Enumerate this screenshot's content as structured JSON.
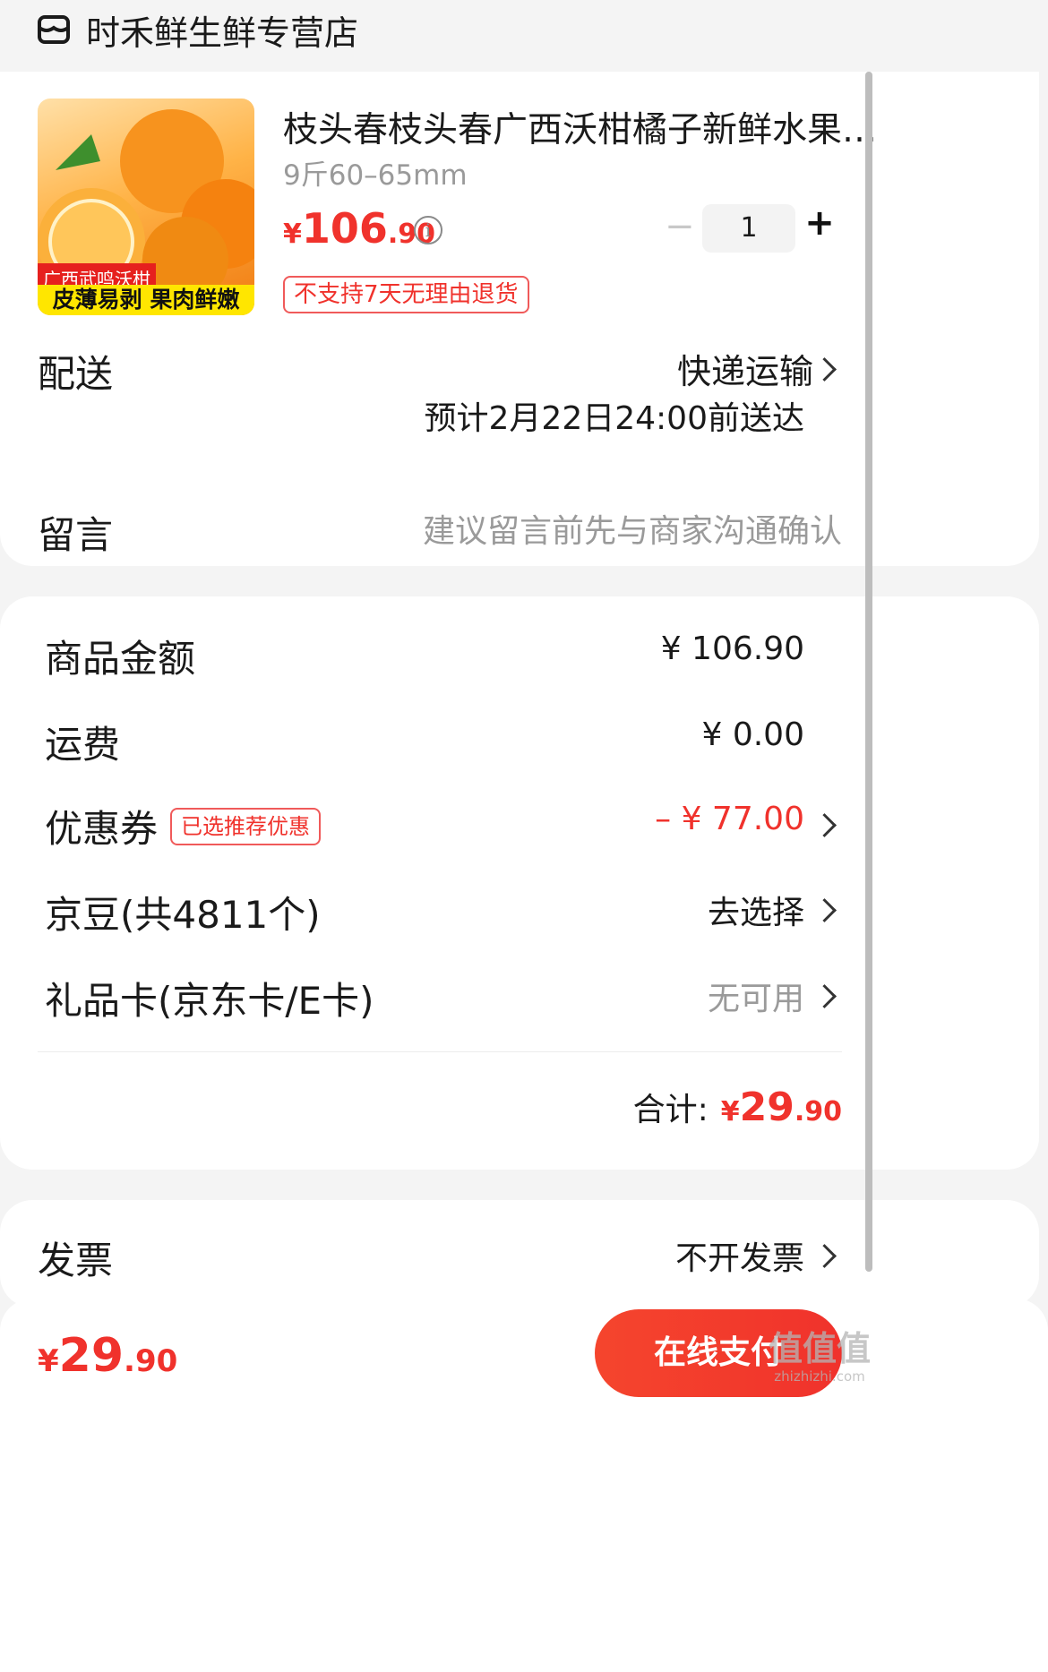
{
  "shop": {
    "name": "时禾鲜生鲜专营店",
    "icon": "shop-icon"
  },
  "product": {
    "title": "枝头春枝头春广西沃柑橘子新鲜水果…",
    "spec": "9斤60–65mm",
    "price_symbol": "¥",
    "price_int": "106",
    "price_dec": ".90",
    "quantity": "1",
    "minus": "−",
    "plus": "+",
    "policy_tag": "不支持7天无理由退货",
    "image_banner_top": "广西武鸣沃柑",
    "image_banner_bottom": "皮薄易剥 果肉鲜嫩"
  },
  "delivery": {
    "label": "配送",
    "method": "快递运输",
    "eta": "预计2月22日24:00前送达"
  },
  "message": {
    "label": "留言",
    "placeholder": "建议留言前先与商家沟通确认"
  },
  "summary": {
    "goods_label": "商品金额",
    "goods_value": "¥ 106.90",
    "shipping_label": "运费",
    "shipping_value": "¥ 0.00",
    "coupon_label": "优惠券",
    "coupon_tag": "已选推荐优惠",
    "coupon_value": "– ¥ 77.00",
    "beans_label": "京豆(共4811个)",
    "beans_value": "去选择",
    "giftcard_label": "礼品卡(京东卡/E卡)",
    "giftcard_value": "无可用",
    "total_label": "合计:",
    "total_symbol": "¥",
    "total_int": "29",
    "total_dec": ".90"
  },
  "invoice": {
    "label": "发票",
    "value": "不开发票"
  },
  "bottom": {
    "symbol": "¥",
    "int": "29",
    "dec": ".90",
    "pay_button": "在线支付"
  },
  "watermark": {
    "text": "值值值",
    "sub": "zhizhizhi.com"
  },
  "colors": {
    "accent": "#f0322c",
    "button": "#f5452d",
    "background": "#f4f4f4"
  }
}
